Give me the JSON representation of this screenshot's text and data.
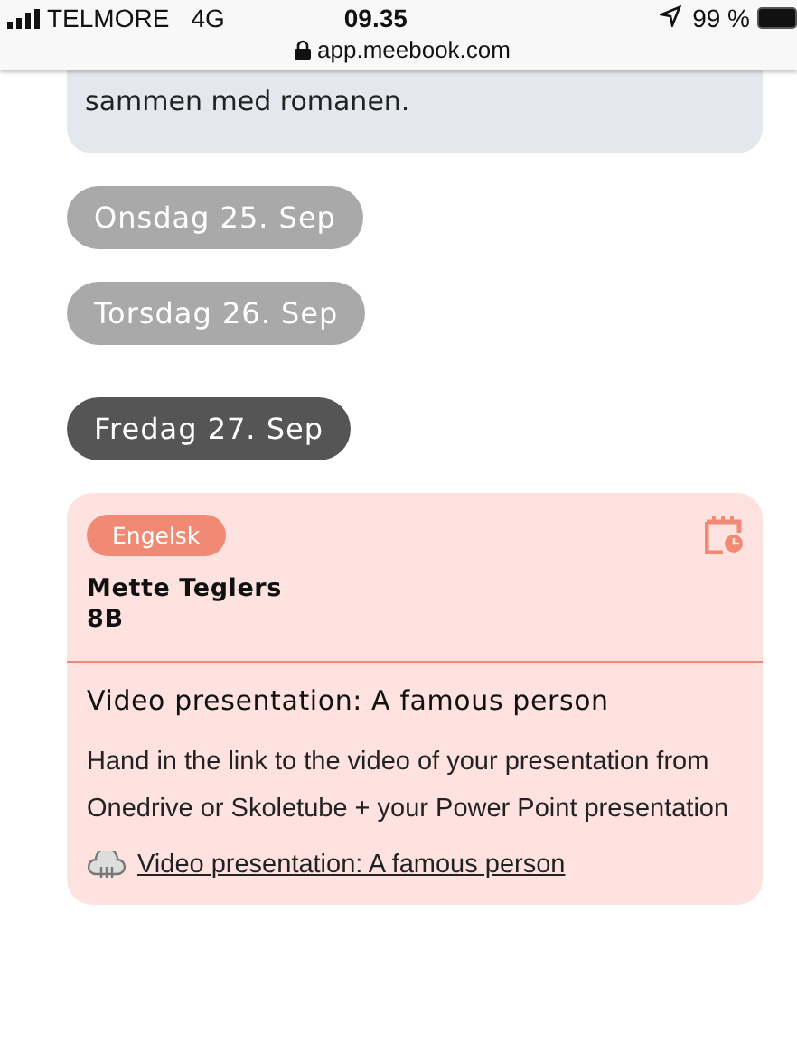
{
  "status_bar": {
    "carrier": "TELMORE",
    "network": "4G",
    "time": "09.35",
    "battery": "99 %",
    "url": "app.meebook.com"
  },
  "previous_card": {
    "text": "sammen med romanen."
  },
  "days": [
    {
      "label": "Onsdag 25. Sep",
      "selected": false
    },
    {
      "label": "Torsdag 26. Sep",
      "selected": false
    },
    {
      "label": "Fredag 27. Sep",
      "selected": true
    }
  ],
  "assignment": {
    "subject": "Engelsk",
    "color": "#f08a75",
    "teacher": "Mette Teglers",
    "class": "8B",
    "title": "Video presentation: A famous person",
    "description": "Hand in the link to the video of your presentation from Onedrive or Skoletube + your Power Point presentation",
    "link": "Video presentation: A famous person"
  }
}
